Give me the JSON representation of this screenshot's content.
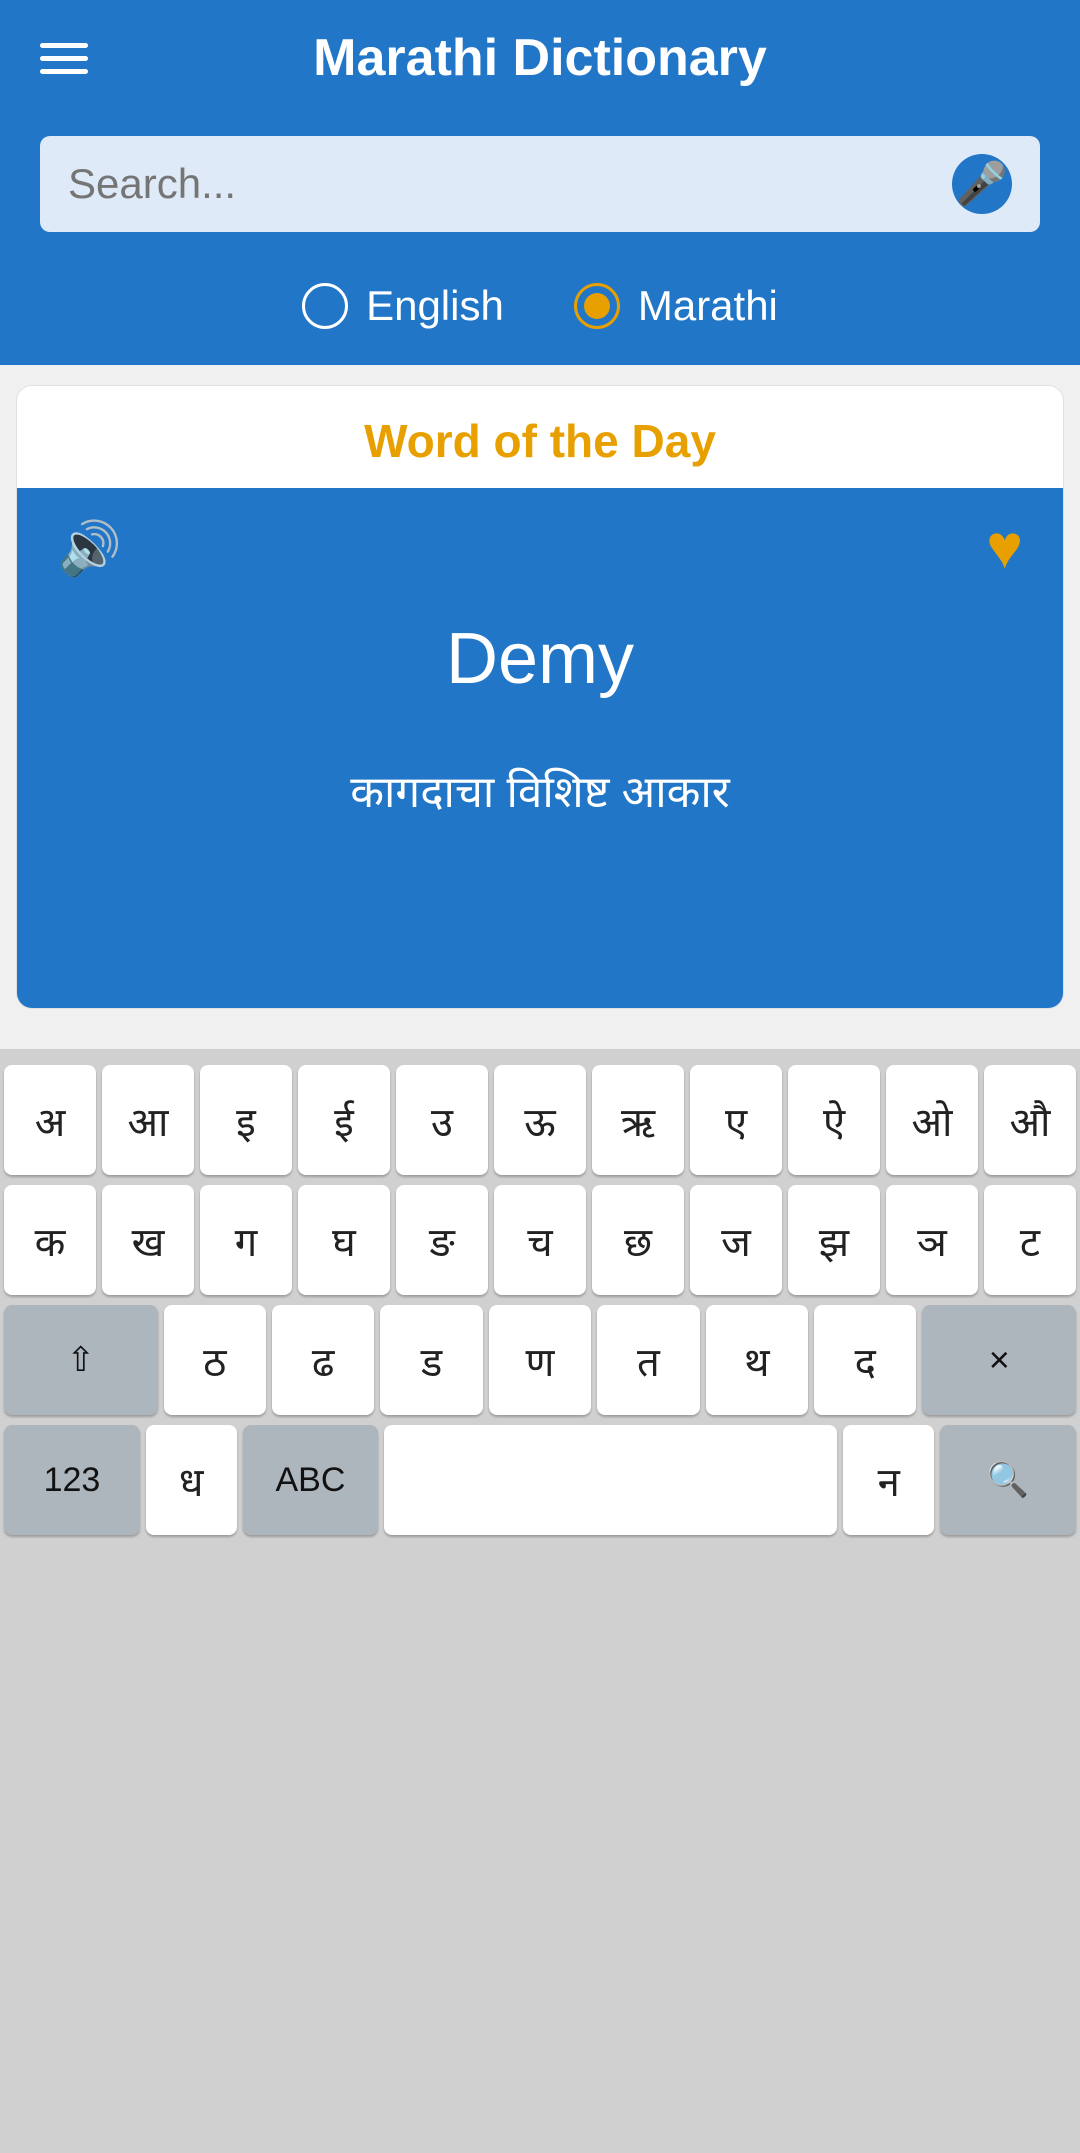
{
  "header": {
    "title": "Marathi Dictionary",
    "menu_label": "menu"
  },
  "search": {
    "placeholder": "Search...",
    "mic_label": "microphone"
  },
  "radio": {
    "options": [
      {
        "label": "English",
        "selected": false
      },
      {
        "label": "Marathi",
        "selected": true
      }
    ]
  },
  "wotd": {
    "section_title": "Word of the Day",
    "word": "Demy",
    "meaning": "कागदाचा विशिष्ट आकार",
    "sound_label": "play-sound",
    "heart_label": "favorite"
  },
  "keyboard": {
    "row1": [
      "अ",
      "आ",
      "इ",
      "ई",
      "उ",
      "ऊ",
      "ऋ",
      "ए",
      "ऐ",
      "ओ",
      "औ"
    ],
    "row2": [
      "क",
      "ख",
      "ग",
      "घ",
      "ङ",
      "च",
      "छ",
      "ज",
      "झ",
      "ञ",
      "ट"
    ],
    "row3_special": "⇧",
    "row3": [
      "ठ",
      "ढ",
      "ड",
      "ण",
      "त",
      "थ",
      "द"
    ],
    "row3_delete": "×",
    "row4_left": [
      "123",
      "ध",
      "ABC"
    ],
    "row4_space": "",
    "row4_right": [
      "न",
      "🔍"
    ]
  },
  "colors": {
    "blue": "#2176C7",
    "orange": "#E8A000",
    "white": "#FFFFFF"
  }
}
